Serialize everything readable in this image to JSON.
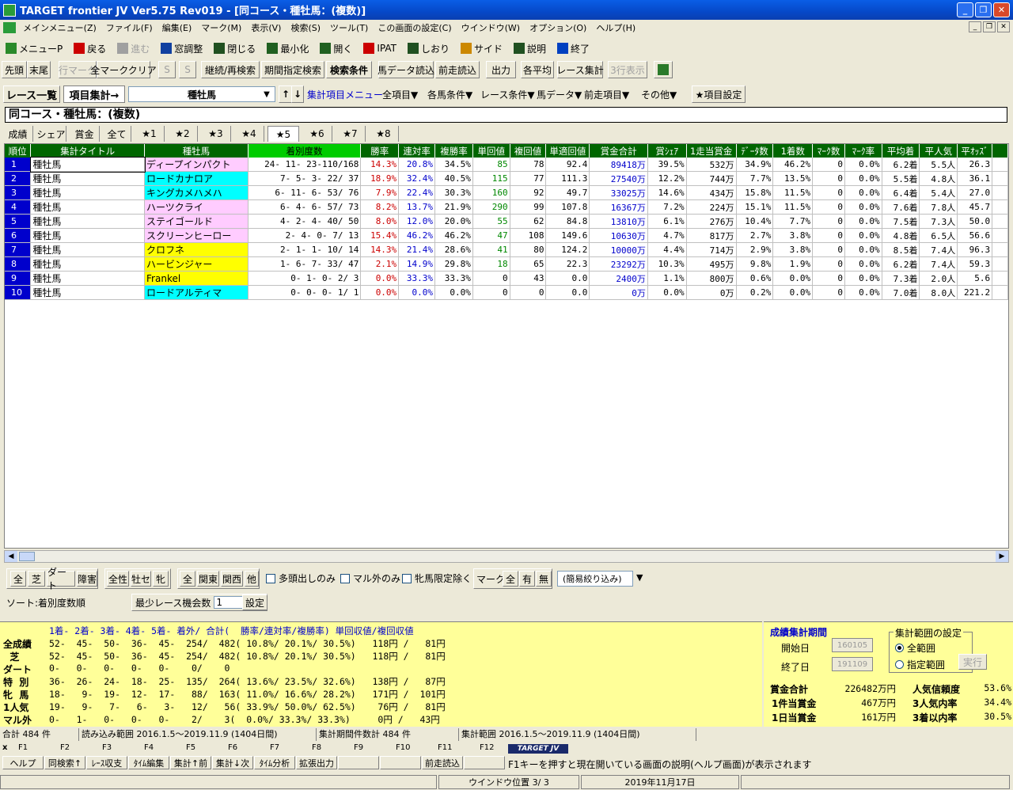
{
  "window": {
    "title": "TARGET frontier JV  Ver5.75  Rev019 - [同コース・種牡馬：(複数)]"
  },
  "menu": [
    "メインメニュー(Z)",
    "ファイル(F)",
    "編集(E)",
    "マーク(M)",
    "表示(V)",
    "検索(S)",
    "ツール(T)",
    "この画面の設定(C)",
    "ウインドウ(W)",
    "オプション(O)",
    "ヘルプ(H)"
  ],
  "toolbar1": [
    {
      "label": "メニューP",
      "icon": "menu-icon",
      "color": "#2a8a2a"
    },
    {
      "label": "戻る",
      "icon": "back-arrow-icon",
      "color": "#cc0000"
    },
    {
      "label": "進む",
      "icon": "forward-arrow-icon",
      "color": "#a0a0a0",
      "disabled": true
    },
    {
      "label": "窓調整",
      "icon": "window-adjust-icon",
      "color": "#1040a0"
    },
    {
      "label": "閉じる",
      "icon": "close-window-icon",
      "color": "#205020"
    },
    {
      "label": "最小化",
      "icon": "minimize-icon",
      "color": "#206020"
    },
    {
      "label": "開く",
      "icon": "open-icon",
      "color": "#206020"
    },
    {
      "label": "IPAT",
      "icon": "pat-icon",
      "color": "#cc0000"
    },
    {
      "label": "しおり",
      "icon": "bookmark-icon",
      "color": "#205020"
    },
    {
      "label": "サイド",
      "icon": "side-icon",
      "color": "#cc8800"
    },
    {
      "label": "説明",
      "icon": "help-icon",
      "color": "#205020"
    },
    {
      "label": "終了",
      "icon": "exit-icon",
      "color": "#0040c0"
    }
  ],
  "toolbar2": {
    "b1": "先頭",
    "b2": "末尾",
    "b3": "行マーク",
    "b4": "全マーククリア",
    "b5": "S",
    "b6": "S",
    "b7": "継続/再検索",
    "b8": "期間指定検索",
    "b9": "検索条件",
    "b10": "馬データ読込",
    "b11": "前走読込",
    "b12": "出力",
    "b13": "各平均",
    "b14": "レース集計",
    "b15": "3行表示"
  },
  "row3": {
    "race_list": "レース一覧",
    "item_agg": "項目集計→",
    "combo_value": "種牡馬",
    "up": "↑",
    "down": "↓",
    "menu_link": "集計項目メニュー",
    "dd1": "全項目▼",
    "dd2": "各馬条件▼",
    "dd3": "レース条件▼",
    "dd4": "馬データ▼",
    "dd5": "前走項目▼",
    "dd6": "その他▼",
    "item_setting": "★項目設定"
  },
  "page_title": "同コース・種牡馬：(複数)",
  "tabs": [
    "成績",
    "シェア",
    "賞金",
    "全て",
    "★1",
    "★2",
    "★3",
    "★4",
    "★5",
    "★6",
    "★7",
    "★8"
  ],
  "selected_tab": "★5",
  "columns": [
    "順位",
    "集計タイトル",
    "種牡馬",
    "着別度数",
    "勝率",
    "連対率",
    "複勝率",
    "単回値",
    "複回値",
    "単適回値",
    "賞金合計",
    "賞ｼｪｱ",
    "1走当賞金",
    "ﾃﾞｰﾀ数",
    "1着数",
    "ﾏｰｸ数",
    "ﾏｰｸ率",
    "平均着",
    "平人気",
    "平ｵｯｽﾞ"
  ],
  "rows": [
    {
      "rank": "1",
      "title": "種牡馬",
      "sire": "ディープインパクト",
      "sire_bg": "#ffccff",
      "record": "24- 11- 23-110/168",
      "win": "14.3%",
      "quin": "20.8%",
      "show": "34.5%",
      "tan": "85",
      "fuku": "78",
      "tekkai": "92.4",
      "prize": "89418万",
      "share": "39.5%",
      "per": "532万",
      "data": "34.9%",
      "first": "46.2%",
      "mark": "0",
      "markr": "0.0%",
      "avg": "6.2着",
      "pop": "5.5人",
      "odds": "26.3"
    },
    {
      "rank": "2",
      "title": "種牡馬",
      "sire": "ロードカナロア",
      "sire_bg": "#00ffff",
      "record": "7-  5-  3- 22/ 37",
      "win": "18.9%",
      "quin": "32.4%",
      "show": "40.5%",
      "tan": "115",
      "fuku": "77",
      "tekkai": "111.3",
      "prize": "27540万",
      "share": "12.2%",
      "per": "744万",
      "data": "7.7%",
      "first": "13.5%",
      "mark": "0",
      "markr": "0.0%",
      "avg": "5.5着",
      "pop": "4.8人",
      "odds": "36.1"
    },
    {
      "rank": "3",
      "title": "種牡馬",
      "sire": "キングカメハメハ",
      "sire_bg": "#00ffff",
      "record": "6- 11-  6- 53/ 76",
      "win": "7.9%",
      "quin": "22.4%",
      "show": "30.3%",
      "tan": "160",
      "fuku": "92",
      "tekkai": "49.7",
      "prize": "33025万",
      "share": "14.6%",
      "per": "434万",
      "data": "15.8%",
      "first": "11.5%",
      "mark": "0",
      "markr": "0.0%",
      "avg": "6.4着",
      "pop": "5.4人",
      "odds": "27.0"
    },
    {
      "rank": "4",
      "title": "種牡馬",
      "sire": "ハーツクライ",
      "sire_bg": "#ffccff",
      "record": "6-  4-  6- 57/ 73",
      "win": "8.2%",
      "quin": "13.7%",
      "show": "21.9%",
      "tan": "290",
      "fuku": "99",
      "tekkai": "107.8",
      "prize": "16367万",
      "share": "7.2%",
      "per": "224万",
      "data": "15.1%",
      "first": "11.5%",
      "mark": "0",
      "markr": "0.0%",
      "avg": "7.6着",
      "pop": "7.8人",
      "odds": "45.7"
    },
    {
      "rank": "5",
      "title": "種牡馬",
      "sire": "ステイゴールド",
      "sire_bg": "#ffccff",
      "record": "4-  2-  4- 40/ 50",
      "win": "8.0%",
      "quin": "12.0%",
      "show": "20.0%",
      "tan": "55",
      "fuku": "62",
      "tekkai": "84.8",
      "prize": "13810万",
      "share": "6.1%",
      "per": "276万",
      "data": "10.4%",
      "first": "7.7%",
      "mark": "0",
      "markr": "0.0%",
      "avg": "7.5着",
      "pop": "7.3人",
      "odds": "50.0"
    },
    {
      "rank": "6",
      "title": "種牡馬",
      "sire": "スクリーンヒーロー",
      "sire_bg": "#ffccff",
      "record": "2-  4-  0-  7/ 13",
      "win": "15.4%",
      "quin": "46.2%",
      "show": "46.2%",
      "tan": "47",
      "fuku": "108",
      "tekkai": "149.6",
      "prize": "10630万",
      "share": "4.7%",
      "per": "817万",
      "data": "2.7%",
      "first": "3.8%",
      "mark": "0",
      "markr": "0.0%",
      "avg": "4.8着",
      "pop": "6.5人",
      "odds": "56.6"
    },
    {
      "rank": "7",
      "title": "種牡馬",
      "sire": "クロフネ",
      "sire_bg": "#ffff00",
      "record": "2-  1-  1- 10/ 14",
      "win": "14.3%",
      "quin": "21.4%",
      "show": "28.6%",
      "tan": "41",
      "fuku": "80",
      "tekkai": "124.2",
      "prize": "10000万",
      "share": "4.4%",
      "per": "714万",
      "data": "2.9%",
      "first": "3.8%",
      "mark": "0",
      "markr": "0.0%",
      "avg": "8.5着",
      "pop": "7.4人",
      "odds": "96.3"
    },
    {
      "rank": "8",
      "title": "種牡馬",
      "sire": "ハービンジャー",
      "sire_bg": "#ffff00",
      "record": "1-  6-  7- 33/ 47",
      "win": "2.1%",
      "quin": "14.9%",
      "show": "29.8%",
      "tan": "18",
      "fuku": "65",
      "tekkai": "22.3",
      "prize": "23292万",
      "share": "10.3%",
      "per": "495万",
      "data": "9.8%",
      "first": "1.9%",
      "mark": "0",
      "markr": "0.0%",
      "avg": "6.2着",
      "pop": "7.4人",
      "odds": "59.3"
    },
    {
      "rank": "9",
      "title": "種牡馬",
      "sire": "Frankel",
      "sire_bg": "#ffff00",
      "record": "0-  1-  0-  2/  3",
      "win": "0.0%",
      "quin": "33.3%",
      "show": "33.3%",
      "tan": "0",
      "fuku": "43",
      "tekkai": "0.0",
      "prize": "2400万",
      "share": "1.1%",
      "per": "800万",
      "data": "0.6%",
      "first": "0.0%",
      "mark": "0",
      "markr": "0.0%",
      "avg": "7.3着",
      "pop": "2.0人",
      "odds": "5.6"
    },
    {
      "rank": "10",
      "title": "種牡馬",
      "sire": "ロードアルティマ",
      "sire_bg": "#00ffff",
      "record": "0-  0-  0-  1/  1",
      "win": "0.0%",
      "quin": "0.0%",
      "show": "0.0%",
      "tan": "0",
      "fuku": "0",
      "tekkai": "0.0",
      "prize": "0万",
      "share": "0.0%",
      "per": "0万",
      "data": "0.2%",
      "first": "0.0%",
      "mark": "0",
      "markr": "0.0%",
      "avg": "7.0着",
      "pop": "8.0人",
      "odds": "221.2"
    }
  ],
  "filters": {
    "g1": [
      "全",
      "芝",
      "ダート",
      "障害"
    ],
    "g2": [
      "全性",
      "牡セ",
      "牝"
    ],
    "g3": [
      "全",
      "関東",
      "関西",
      "他"
    ],
    "c1": "多頭出しのみ",
    "c2": "マル外のみ",
    "c3": "牝馬限定除く",
    "mark_label": "マーク",
    "g4": [
      "全",
      "有",
      "無"
    ],
    "narrow": "(簡易絞り込み)"
  },
  "sort": {
    "label": "ソート:着別度数順",
    "min_label": "最少レース機会数",
    "min_value": "1",
    "set_btn": "設定"
  },
  "summary": {
    "header": "1着- 2着- 3着- 4着- 5着- 着外/ 合計(  勝率/連対率/複勝率) 単回収値/複回収値",
    "rows": [
      {
        "label": "全成績",
        "text": "52-  45-  50-  36-  45-  254/  482( 10.8%/ 20.1%/ 30.5%)   118円 /   81円"
      },
      {
        "label": "  芝",
        "text": "52-  45-  50-  36-  45-  254/  482( 10.8%/ 20.1%/ 30.5%)   118円 /   81円"
      },
      {
        "label": "ダート",
        "text": "0-   0-   0-   0-   0-    0/    0"
      },
      {
        "label": "特  別",
        "text": "36-  26-  24-  18-  25-  135/  264( 13.6%/ 23.5%/ 32.6%)   138円 /   87円"
      },
      {
        "label": "牝  馬",
        "text": "18-   9-  19-  12-  17-   88/  163( 11.0%/ 16.6%/ 28.2%)   171円 /  101円"
      },
      {
        "label": "1人気",
        "text": "19-   9-   7-   6-   3-   12/   56( 33.9%/ 50.0%/ 62.5%)    76円 /   81円"
      },
      {
        "label": "マル外",
        "text": "0-   1-   0-   0-   0-    2/    3(  0.0%/ 33.3%/ 33.3%)     0円 /   43円"
      }
    ]
  },
  "period": {
    "title": "成績集計期間",
    "start_label": "開始日",
    "start": "160105",
    "end_label": "終了日",
    "end": "191109",
    "range_title": "集計範囲の設定",
    "r1": "全範囲",
    "r2": "指定範囲",
    "exec": "実行",
    "s1l": "賞金合計",
    "s1v": "226482万円",
    "s2l": "人気信頼度",
    "s2v": "53.6%",
    "s3l": "1件当賞金",
    "s3v": "467万円",
    "s4l": "3人気内率",
    "s4v": "34.4%",
    "s5l": "1日当賞金",
    "s5v": "161万円",
    "s6l": "3着以内率",
    "s6v": "30.5%"
  },
  "status1": {
    "c1": "合計 484 件",
    "c2": "読み込み範囲 2016.1.5～2019.11.9 (1404日間)",
    "c3": "集計期間件数計 484 件",
    "c4": "集計範囲 2016.1.5～2019.11.9 (1404日間)"
  },
  "fkeys": [
    {
      "n": "F1",
      "l": "ヘルプ"
    },
    {
      "n": "F2",
      "l": "同検索↑"
    },
    {
      "n": "F3",
      "l": "ﾚｰｽ収支"
    },
    {
      "n": "F4",
      "l": "ﾀｲﾑ編集"
    },
    {
      "n": "F5",
      "l": "集計↑前"
    },
    {
      "n": "F6",
      "l": "集計↓次"
    },
    {
      "n": "F7",
      "l": "ﾀｲﾑ分析"
    },
    {
      "n": "F8",
      "l": "拡張出力"
    },
    {
      "n": "F9",
      "l": ""
    },
    {
      "n": "F10",
      "l": ""
    },
    {
      "n": "F11",
      "l": "前走読込"
    },
    {
      "n": "F12",
      "l": ""
    }
  ],
  "logo": "TARGET JV",
  "help_msg": "F1キーを押すと現在開いている画面の説明(ヘルプ画面)が表示されます",
  "status2": {
    "window_pos": "ウインドウ位置 3/ 3",
    "date": "2019年11月17日"
  }
}
